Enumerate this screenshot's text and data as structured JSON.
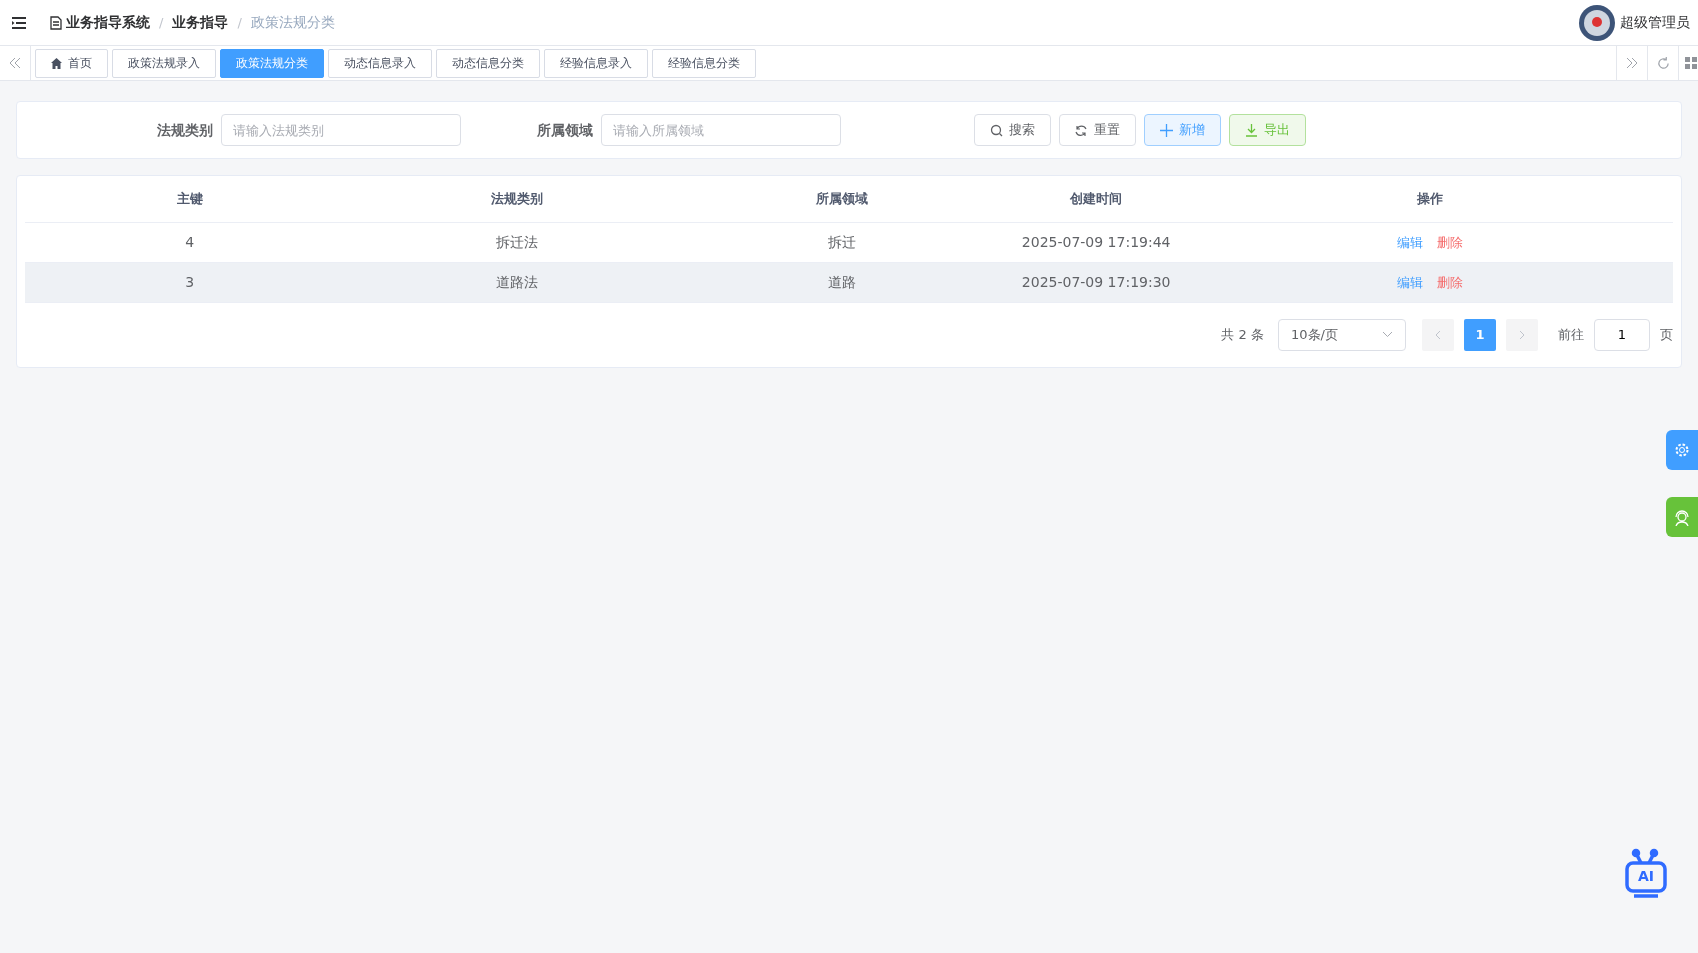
{
  "breadcrumb": [
    {
      "label": "业务指导系统",
      "current": false
    },
    {
      "separator": "/",
      "label": "业务指导",
      "current": false
    },
    {
      "separator": "/",
      "label": "政策法规分类",
      "current": true
    }
  ],
  "user": {
    "name": "超级管理员"
  },
  "tabs": [
    {
      "label": "首页",
      "selected": false,
      "home": true
    },
    {
      "label": "政策法规录入",
      "selected": false,
      "home": false
    },
    {
      "label": "政策法规分类",
      "selected": true,
      "home": false
    },
    {
      "label": "动态信息录入",
      "selected": false,
      "home": false
    },
    {
      "label": "动态信息分类",
      "selected": false,
      "home": false
    },
    {
      "label": "经验信息录入",
      "selected": false,
      "home": false
    },
    {
      "label": "经验信息分类",
      "selected": false,
      "home": false
    }
  ],
  "filters": [
    {
      "label": "法规类别",
      "placeholder": "请输入法规类别"
    },
    {
      "label": "所属领域",
      "placeholder": "请输入所属领域"
    }
  ],
  "buttons": [
    {
      "label": "搜索",
      "kind": "search"
    },
    {
      "label": "重置",
      "kind": "reset"
    },
    {
      "label": "新增",
      "kind": "add"
    },
    {
      "label": "导出",
      "kind": "export"
    }
  ],
  "table": {
    "columns": [
      "主键",
      "法规类别",
      "所属领域",
      "创建时间",
      "操作"
    ],
    "rows": [
      {
        "cells": [
          "4",
          "拆迁法",
          "拆迁",
          "2025-07-09 17:19:44"
        ],
        "actions": [
          "编辑",
          "删除"
        ],
        "hover": false
      },
      {
        "cells": [
          "3",
          "道路法",
          "道路",
          "2025-07-09 17:19:30"
        ],
        "actions": [
          "编辑",
          "删除"
        ],
        "hover": true
      }
    ]
  },
  "pagination": {
    "total": "共 2 条",
    "page_size": "10条/页",
    "pages": [
      {
        "label": "1",
        "selected": true
      }
    ],
    "goto_label": "前往",
    "goto_value": "1",
    "goto_suffix": "页"
  },
  "ai_badge": "AI"
}
